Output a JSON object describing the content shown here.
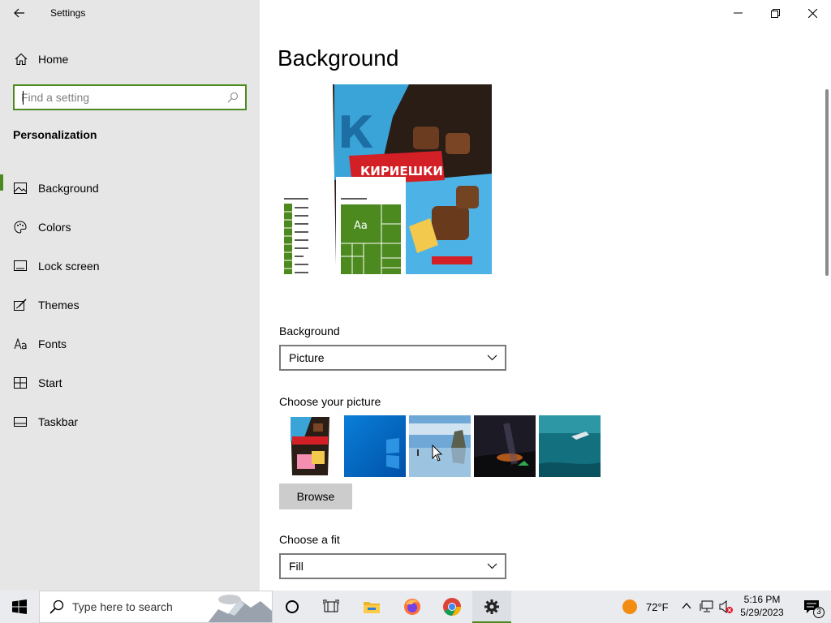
{
  "window": {
    "app_title": "Settings",
    "controls": [
      "minimize",
      "restore",
      "close"
    ]
  },
  "sidebar": {
    "home_label": "Home",
    "search_placeholder": "Find a setting",
    "section_title": "Personalization",
    "items": [
      {
        "label": "Background",
        "icon": "picture-icon",
        "active": true
      },
      {
        "label": "Colors",
        "icon": "palette-icon"
      },
      {
        "label": "Lock screen",
        "icon": "lock-screen-icon"
      },
      {
        "label": "Themes",
        "icon": "themes-icon"
      },
      {
        "label": "Fonts",
        "icon": "fonts-icon"
      },
      {
        "label": "Start",
        "icon": "start-icon"
      },
      {
        "label": "Taskbar",
        "icon": "taskbar-icon"
      }
    ]
  },
  "main": {
    "page_title": "Background",
    "preview": {
      "tile_label": "Aa",
      "image_caption_text": "КИРИЕШКИ",
      "image_logo_letter": "К"
    },
    "background_label": "Background",
    "background_value": "Picture",
    "choose_picture_label": "Choose your picture",
    "thumbnails": [
      "kirieshki-pack",
      "windows-blue",
      "beach-rocks",
      "night-sky",
      "underwater-swimmer"
    ],
    "browse_label": "Browse",
    "fit_label": "Choose a fit",
    "fit_value": "Fill"
  },
  "taskbar": {
    "search_placeholder": "Type here to search",
    "pinned": [
      "cortana-icon",
      "task-view-icon",
      "file-explorer-icon",
      "firefox-icon",
      "chrome-icon",
      "settings-icon"
    ],
    "weather": "72°F",
    "time": "5:16 PM",
    "date": "5/29/2023",
    "notification_count": "3"
  },
  "colors": {
    "accent": "#4c8a1f",
    "sidebar_bg": "#e6e6e6",
    "taskbar_bg": "#e9ebee"
  }
}
